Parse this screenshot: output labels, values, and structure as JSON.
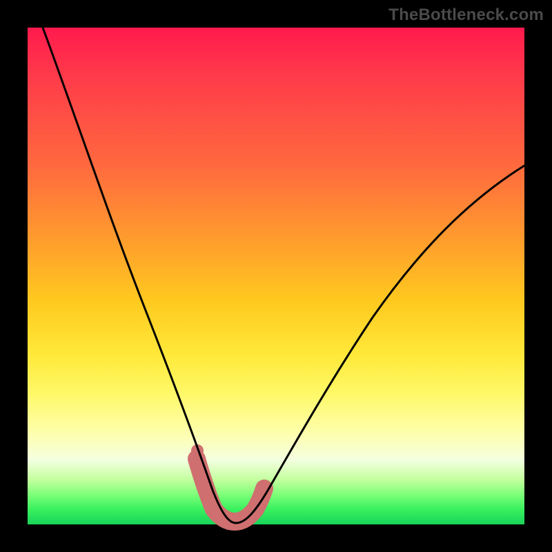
{
  "watermark": "TheBottleneck.com",
  "chart_data": {
    "type": "line",
    "title": "",
    "xlabel": "",
    "ylabel": "",
    "xlim": [
      0,
      100
    ],
    "ylim": [
      0,
      100
    ],
    "grid": false,
    "legend": false,
    "notes": "Bottleneck-style V-curve over a heat gradient. X and Y approx percentages read off the image.",
    "series": [
      {
        "name": "bottleneck-curve",
        "color": "#000000",
        "x": [
          3,
          8,
          14,
          20,
          26,
          30,
          33,
          35,
          37,
          38.5,
          40,
          42,
          45,
          50,
          56,
          64,
          72,
          80,
          88,
          96,
          100
        ],
        "y": [
          100,
          86,
          72,
          58,
          42,
          30,
          20,
          12,
          6,
          2,
          0.5,
          0.5,
          3,
          10,
          22,
          36,
          48,
          58,
          66,
          72,
          75
        ]
      },
      {
        "name": "highlight-dip",
        "color": "#cf6f6f",
        "x": [
          34,
          36,
          38,
          40,
          42,
          44,
          46,
          34.2
        ],
        "y": [
          13,
          7,
          2.5,
          0.8,
          0.8,
          2.5,
          5.5,
          15
        ]
      }
    ]
  },
  "colors": {
    "background": "#000000",
    "curve": "#000000",
    "highlight": "#cf6f6f",
    "watermark": "#4a4a4a"
  }
}
